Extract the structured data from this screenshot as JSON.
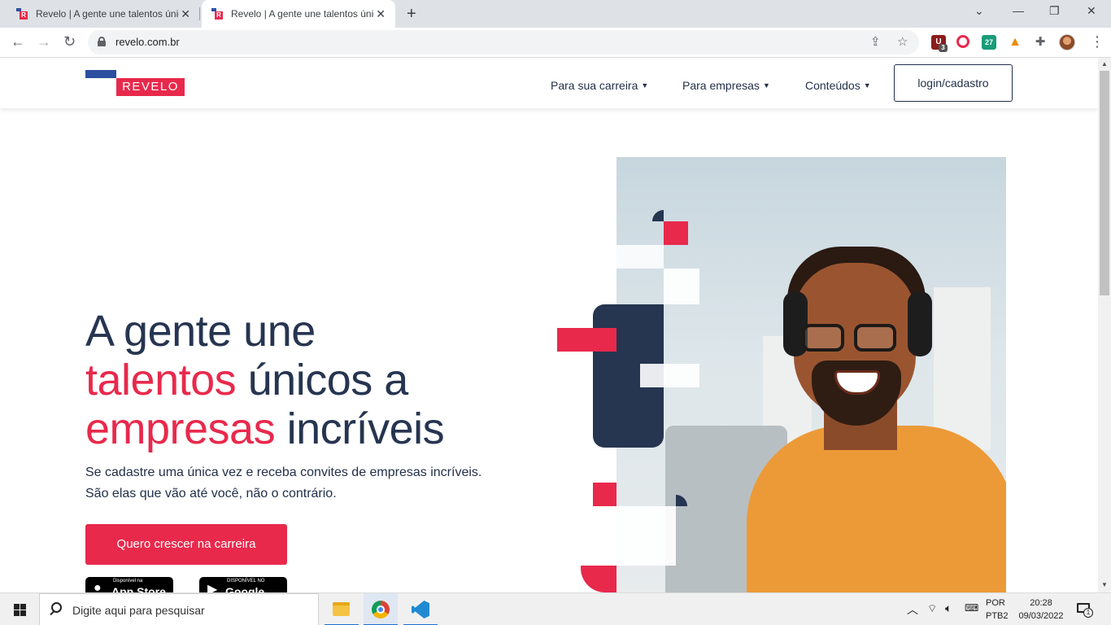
{
  "browser": {
    "tabs": [
      {
        "title": "Revelo | A gente une talentos únicos a empresas incríveis",
        "active": false
      },
      {
        "title": "Revelo | A gente une talentos únicos a empresas incríveis",
        "active": true
      }
    ],
    "url": "revelo.com.br",
    "extension_badges": {
      "shield": "3",
      "twentyseven": "27"
    }
  },
  "site": {
    "logo_text": "REVELO",
    "nav": [
      {
        "label": "Para sua carreira"
      },
      {
        "label": "Para empresas"
      },
      {
        "label": "Conteúdos"
      }
    ],
    "login_label": "login/cadastro"
  },
  "hero": {
    "title_line1": "A gente une",
    "title_hl1": "talentos",
    "title_line2_rest": " únicos a",
    "title_hl2": "empresas",
    "title_line3_rest": " incríveis",
    "subtitle_line1": "Se cadastre uma única vez e receba convites de empresas incríveis.",
    "subtitle_line2": "São elas que vão até você, não o contrário.",
    "cta_label": "Quero crescer na carreira",
    "appstore_small": "Disponível na",
    "appstore_big": "App Store",
    "googleplay_small": "DISPONÍVEL NO",
    "googleplay_big": "Google Play"
  },
  "colors": {
    "brand_red": "#e8294c",
    "brand_navy": "#263550",
    "brand_blue": "#2d4fa0"
  },
  "taskbar": {
    "search_placeholder": "Digite aqui para pesquisar",
    "lang_line1": "POR",
    "lang_line2": "PTB2",
    "time": "20:28",
    "date": "09/03/2022",
    "notification_count": "1"
  }
}
